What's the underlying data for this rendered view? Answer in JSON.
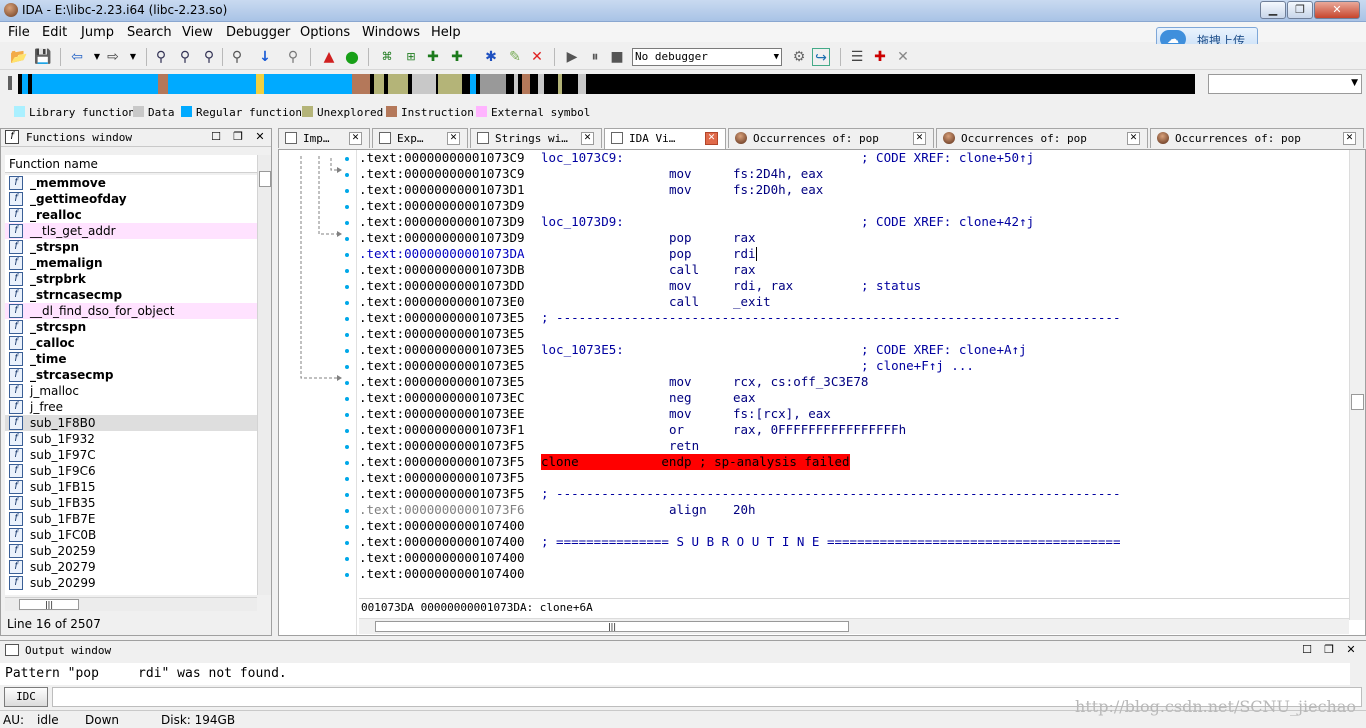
{
  "window": {
    "title": "IDA - E:\\libc-2.23.i64 (libc-2.23.so)",
    "min_glyph": "▁",
    "max_glyph": "❐",
    "close_glyph": "✕"
  },
  "menu": [
    "File",
    "Edit",
    "Jump",
    "Search",
    "View",
    "Debugger",
    "Options",
    "Windows",
    "Help"
  ],
  "upload_widget": {
    "label": "拖拽上传",
    "icon": "cloud-icon"
  },
  "toolbar": {
    "debugger": "No debugger"
  },
  "legend": [
    {
      "label": "Library function",
      "color": "#aaf0ff"
    },
    {
      "label": "Data",
      "color": "#c8c8c8"
    },
    {
      "label": "Regular function",
      "color": "#00aaff"
    },
    {
      "label": "Unexplored",
      "color": "#b4b478"
    },
    {
      "label": "Instruction",
      "color": "#b4785a"
    },
    {
      "label": "External symbol",
      "color": "#ffb4ff"
    }
  ],
  "functions_window": {
    "title": "Functions window",
    "column_header": "Function name",
    "status": "Line 16 of 2507",
    "items": [
      {
        "name": "_memmove",
        "style": "bold"
      },
      {
        "name": "_gettimeofday",
        "style": "bold"
      },
      {
        "name": "_realloc",
        "style": "bold"
      },
      {
        "name": "__tls_get_addr",
        "style": "ext"
      },
      {
        "name": "_strspn",
        "style": "bold"
      },
      {
        "name": "_memalign",
        "style": "bold"
      },
      {
        "name": "_strpbrk",
        "style": "bold"
      },
      {
        "name": "_strncasecmp",
        "style": "bold"
      },
      {
        "name": "__dl_find_dso_for_object",
        "style": "ext"
      },
      {
        "name": "_strcspn",
        "style": "bold"
      },
      {
        "name": "_calloc",
        "style": "bold"
      },
      {
        "name": "_time",
        "style": "bold"
      },
      {
        "name": "_strcasecmp",
        "style": "bold"
      },
      {
        "name": "j_malloc",
        "style": "normal"
      },
      {
        "name": "j_free",
        "style": "normal"
      },
      {
        "name": "sub_1F8B0",
        "style": "sel"
      },
      {
        "name": "sub_1F932",
        "style": "normal"
      },
      {
        "name": "sub_1F97C",
        "style": "normal"
      },
      {
        "name": "sub_1F9C6",
        "style": "normal"
      },
      {
        "name": "sub_1FB15",
        "style": "normal"
      },
      {
        "name": "sub_1FB35",
        "style": "normal"
      },
      {
        "name": "sub_1FB7E",
        "style": "normal"
      },
      {
        "name": "sub_1FC0B",
        "style": "normal"
      },
      {
        "name": "sub_20259",
        "style": "normal"
      },
      {
        "name": "sub_20279",
        "style": "normal"
      },
      {
        "name": "sub_20299",
        "style": "normal"
      }
    ]
  },
  "tabs": [
    {
      "label": "Imp…",
      "icon": "imports-icon"
    },
    {
      "label": "Exp…",
      "icon": "exports-icon"
    },
    {
      "label": "Strings wi…",
      "icon": "strings-icon"
    },
    {
      "label": "IDA Vi…",
      "icon": "ida-view-icon",
      "active": true
    },
    {
      "label": "Occurrences of: pop",
      "icon": "occurrences-icon"
    },
    {
      "label": "Occurrences of: pop",
      "icon": "occurrences-icon"
    },
    {
      "label": "Occurrences of: pop",
      "icon": "occurrences-icon"
    }
  ],
  "disasm": {
    "lines": [
      {
        "addr": ".text:00000000001073C9",
        "label": "loc_1073C9:",
        "mnem": "",
        "ops": "",
        "comment": "; CODE XREF: clone+50↑j"
      },
      {
        "addr": ".text:00000000001073C9",
        "label": "",
        "mnem": "mov",
        "ops": "fs:2D4h, eax",
        "comment": ""
      },
      {
        "addr": ".text:00000000001073D1",
        "label": "",
        "mnem": "mov",
        "ops": "fs:2D0h, eax",
        "comment": ""
      },
      {
        "addr": ".text:00000000001073D9",
        "label": "",
        "mnem": "",
        "ops": "",
        "comment": ""
      },
      {
        "addr": ".text:00000000001073D9",
        "label": "loc_1073D9:",
        "mnem": "",
        "ops": "",
        "comment": "; CODE XREF: clone+42↑j"
      },
      {
        "addr": ".text:00000000001073D9",
        "label": "",
        "mnem": "pop",
        "ops": "rax",
        "comment": ""
      },
      {
        "addr": ".text:00000000001073DA",
        "label": "",
        "mnem": "pop",
        "ops": "rdi",
        "comment": "",
        "highlight": true
      },
      {
        "addr": ".text:00000000001073DB",
        "label": "",
        "mnem": "call",
        "ops": "rax",
        "comment": ""
      },
      {
        "addr": ".text:00000000001073DD",
        "label": "",
        "mnem": "mov",
        "ops": "rdi, rax",
        "comment": "; status"
      },
      {
        "addr": ".text:00000000001073E0",
        "label": "",
        "mnem": "call",
        "ops": "_exit",
        "comment": ""
      },
      {
        "addr": ".text:00000000001073E5",
        "label": "",
        "mnem": "",
        "ops": "",
        "comment": "",
        "separator": "; ---------------------------------------------------------------------------"
      },
      {
        "addr": ".text:00000000001073E5",
        "label": "",
        "mnem": "",
        "ops": "",
        "comment": ""
      },
      {
        "addr": ".text:00000000001073E5",
        "label": "loc_1073E5:",
        "mnem": "",
        "ops": "",
        "comment": "; CODE XREF: clone+A↑j"
      },
      {
        "addr": ".text:00000000001073E5",
        "label": "",
        "mnem": "",
        "ops": "",
        "comment": "; clone+F↑j ..."
      },
      {
        "addr": ".text:00000000001073E5",
        "label": "",
        "mnem": "mov",
        "ops": "rcx, cs:off_3C3E78",
        "comment": ""
      },
      {
        "addr": ".text:00000000001073EC",
        "label": "",
        "mnem": "neg",
        "ops": "eax",
        "comment": ""
      },
      {
        "addr": ".text:00000000001073EE",
        "label": "",
        "mnem": "mov",
        "ops": "fs:[rcx], eax",
        "comment": ""
      },
      {
        "addr": ".text:00000000001073F1",
        "label": "",
        "mnem": "or",
        "ops": "rax, 0FFFFFFFFFFFFFFFFh",
        "comment": ""
      },
      {
        "addr": ".text:00000000001073F5",
        "label": "",
        "mnem": "retn",
        "ops": "",
        "comment": ""
      },
      {
        "addr": ".text:00000000001073F5",
        "label": "",
        "mnem": "",
        "ops": "",
        "comment": "",
        "error": "clone           endp ; sp-analysis failed"
      },
      {
        "addr": ".text:00000000001073F5",
        "label": "",
        "mnem": "",
        "ops": "",
        "comment": ""
      },
      {
        "addr": ".text:00000000001073F5",
        "label": "",
        "mnem": "",
        "ops": "",
        "comment": "",
        "separator": "; ---------------------------------------------------------------------------"
      },
      {
        "addr": ".text:00000000001073F6",
        "label": "",
        "mnem": "align",
        "ops": "20h",
        "comment": "",
        "grey_addr": true
      },
      {
        "addr": ".text:0000000000107400",
        "label": "",
        "mnem": "",
        "ops": "",
        "comment": ""
      },
      {
        "addr": ".text:0000000000107400",
        "label": "",
        "mnem": "",
        "ops": "",
        "comment": "",
        "separator": "; =============== S U B R O U T I N E ======================================="
      },
      {
        "addr": ".text:0000000000107400",
        "label": "",
        "mnem": "",
        "ops": "",
        "comment": ""
      },
      {
        "addr": ".text:0000000000107400",
        "label": "",
        "mnem": "",
        "ops": "",
        "comment": ""
      }
    ],
    "address_bar": "001073DA 00000000001073DA: clone+6A"
  },
  "output_window": {
    "title": "Output window",
    "text": "Pattern \"pop     rdi\" was not found.",
    "idc_label": "IDC"
  },
  "statusbar": {
    "au_label": "AU:",
    "au_state": "idle",
    "direction": "Down",
    "disk": "Disk: 194GB"
  },
  "watermark": "http://blog.csdn.net/SCNU_jiechao"
}
